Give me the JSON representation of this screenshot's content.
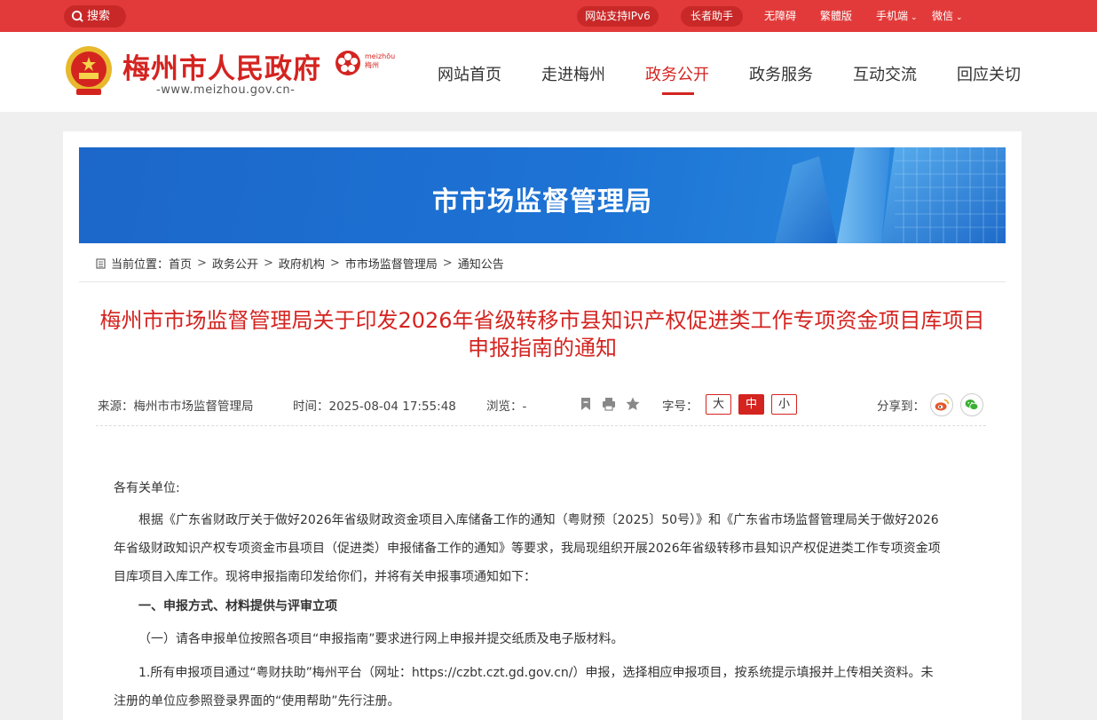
{
  "topbar": {
    "search_label": "搜索",
    "ipv6_label": "网站支持IPv6",
    "elder_label": "长者助手",
    "accessibility_label": "无障碍",
    "traditional_label": "繁體版",
    "mobile_label": "手机端",
    "wechat_label": "微信"
  },
  "header": {
    "site_title": "梅州市人民政府",
    "site_url": "-www.meizhou.gov.cn-",
    "city_logo_pinyin": "meizhōu",
    "city_logo_cn": "梅州"
  },
  "nav": {
    "items": [
      "网站首页",
      "走进梅州",
      "政务公开",
      "政务服务",
      "互动交流",
      "回应关切"
    ],
    "active_index": 2
  },
  "banner": {
    "title": "市市场监督管理局"
  },
  "breadcrumb": {
    "prefix": "当前位置：",
    "items": [
      "首页",
      "政务公开",
      "政府机构",
      "市市场监督管理局",
      "通知公告"
    ],
    "separator": ">"
  },
  "article": {
    "title_line1": "梅州市市场监督管理局关于印发2026年省级转移市县知识产权促进类工作专项资金项目库项目",
    "title_line2": "申报指南的通知",
    "source": "来源：梅州市市场监督管理局",
    "time": "时间：2025-08-04 17:55:48",
    "views": "浏览：-",
    "font_size_label": "字号：",
    "font_sizes": [
      "大",
      "中",
      "小"
    ],
    "share_label": "分享到：",
    "salutation": "各有关单位:",
    "para1_lines": [
      "根据《广东省财政厅关于做好2026年省级财政资金项目入库储备工作的通知（粤财预〔2025〕50号）》和《广东省市场监督管理局关于做好2026",
      "年省级财政知识产权专项资金市县项目（促进类）申报储备工作的通知》等要求，我局现组织开展2026年省级转移市县知识产权促进类工作专项资金项",
      "目库项目入库工作。现将申报指南印发给你们，并将有关申报事项通知如下："
    ],
    "section1_heading": "一、申报方式、材料提供与评审立项",
    "item1": "（一）请各申报单位按照各项目“申报指南”要求进行网上申报并提交纸质及电子版材料。",
    "item1_1_lines": [
      "1.所有申报项目通过“粤财扶助”梅州平台（网址：https://czbt.czt.gd.gov.cn/）申报，选择相应申报项目，按系统提示填报并上传相关资料。未",
      "注册的单位应参照登录界面的“使用帮助”先行注册。"
    ]
  },
  "colors": {
    "accent_red": "#d42420",
    "topbar_red": "#e23a3a",
    "banner_blue": "#1d6fd0"
  }
}
